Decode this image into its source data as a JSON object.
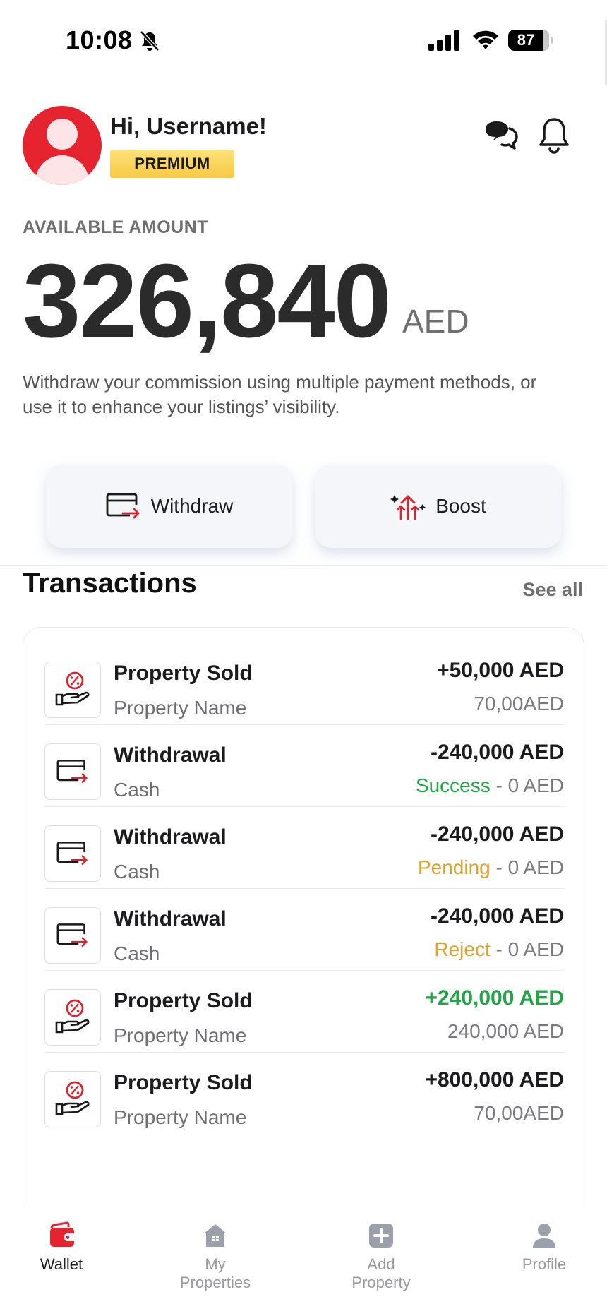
{
  "status_bar": {
    "time": "10:08",
    "battery": "87"
  },
  "header": {
    "greeting": "Hi, Username!",
    "badge": "PREMIUM"
  },
  "balance": {
    "label": "AVAILABLE AMOUNT",
    "amount": "326,840",
    "currency": "AED",
    "description": "Withdraw your commission using multiple payment methods, or use it to enhance your listings’ visibility."
  },
  "actions": {
    "withdraw_label": "Withdraw",
    "boost_label": "Boost"
  },
  "transactions": {
    "title": "Transactions",
    "see_all": "See all",
    "items": [
      {
        "icon": "commission-hand-icon",
        "title": "Property Sold",
        "subtitle": "Property Name",
        "amount": "+50,000 AED",
        "status": "",
        "detail": "70,00AED"
      },
      {
        "icon": "card-withdraw-icon",
        "title": "Withdrawal",
        "subtitle": "Cash",
        "amount": "-240,000 AED",
        "status": "Success",
        "detail": " - 0 AED"
      },
      {
        "icon": "card-withdraw-icon",
        "title": "Withdrawal",
        "subtitle": "Cash",
        "amount": "-240,000 AED",
        "status": "Pending",
        "detail": " - 0 AED"
      },
      {
        "icon": "card-withdraw-icon",
        "title": "Withdrawal",
        "subtitle": "Cash",
        "amount": "-240,000 AED",
        "status": "Reject",
        "detail": " - 0 AED"
      },
      {
        "icon": "commission-hand-icon",
        "title": "Property Sold",
        "subtitle": "Property Name",
        "amount": "+240,000 AED",
        "status": "",
        "detail": "240,000 AED"
      },
      {
        "icon": "commission-hand-icon",
        "title": "Property Sold",
        "subtitle": "Property Name",
        "amount": "+800,000 AED",
        "status": "",
        "detail": "70,00AED"
      }
    ]
  },
  "nav": {
    "wallet": "Wallet",
    "my_properties": "My\nProperties",
    "add_property": "Add\nProperty",
    "profile": "Profile"
  },
  "colors": {
    "brand_red": "#e5242f",
    "success_green": "#22a447",
    "pending_amber": "#e0a02a",
    "premium_gold": "#f7c843"
  }
}
